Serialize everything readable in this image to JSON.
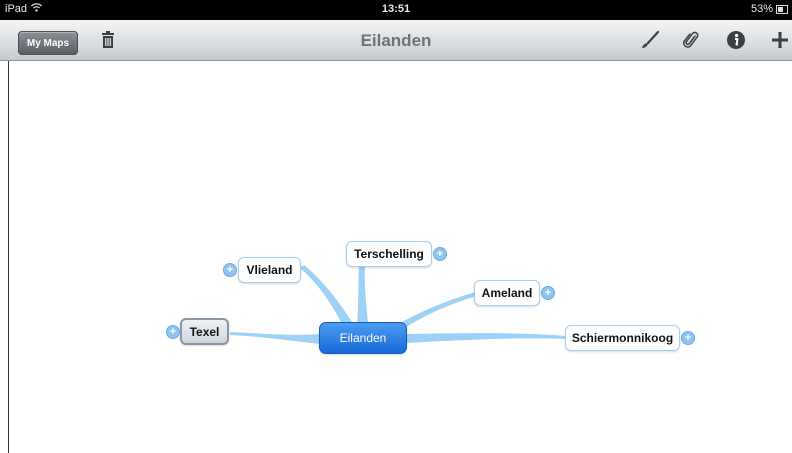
{
  "status_bar": {
    "device": "iPad",
    "time": "13:51",
    "battery": "53%"
  },
  "toolbar": {
    "my_maps_label": "My Maps",
    "title": "Eilanden",
    "icons": [
      "trash-icon",
      "brush-icon",
      "paperclip-icon",
      "info-icon",
      "plus-icon"
    ]
  },
  "mindmap": {
    "central": "Eilanden",
    "branches": [
      "Terschelling",
      "Vlieland",
      "Ameland",
      "Texel",
      "Schiermonnikoog"
    ]
  },
  "colors": {
    "accent": "#1f74e0",
    "branch_line": "#9fd0f5",
    "toolbar": "#dfe2e6"
  }
}
